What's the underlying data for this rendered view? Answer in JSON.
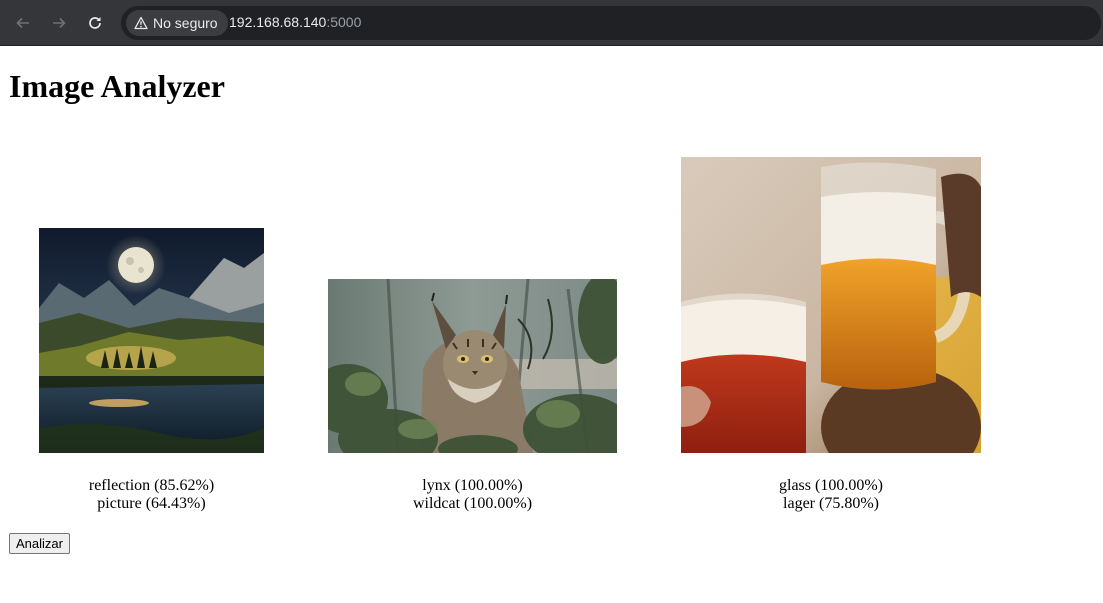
{
  "browser": {
    "security_label": "No seguro",
    "url_host": "192.168.68.140",
    "url_port": ":5000"
  },
  "page": {
    "title": "Image Analyzer",
    "analyze_button": "Analizar"
  },
  "results": [
    {
      "image": "moonlit-mountain-lake",
      "labels": [
        "reflection (85.62%)",
        "picture (64.43%)"
      ]
    },
    {
      "image": "lynx-in-foliage",
      "labels": [
        "lynx (100.00%)",
        "wildcat (100.00%)"
      ]
    },
    {
      "image": "beer-mugs-toast",
      "labels": [
        "glass (100.00%)",
        "lager (75.80%)"
      ]
    }
  ]
}
